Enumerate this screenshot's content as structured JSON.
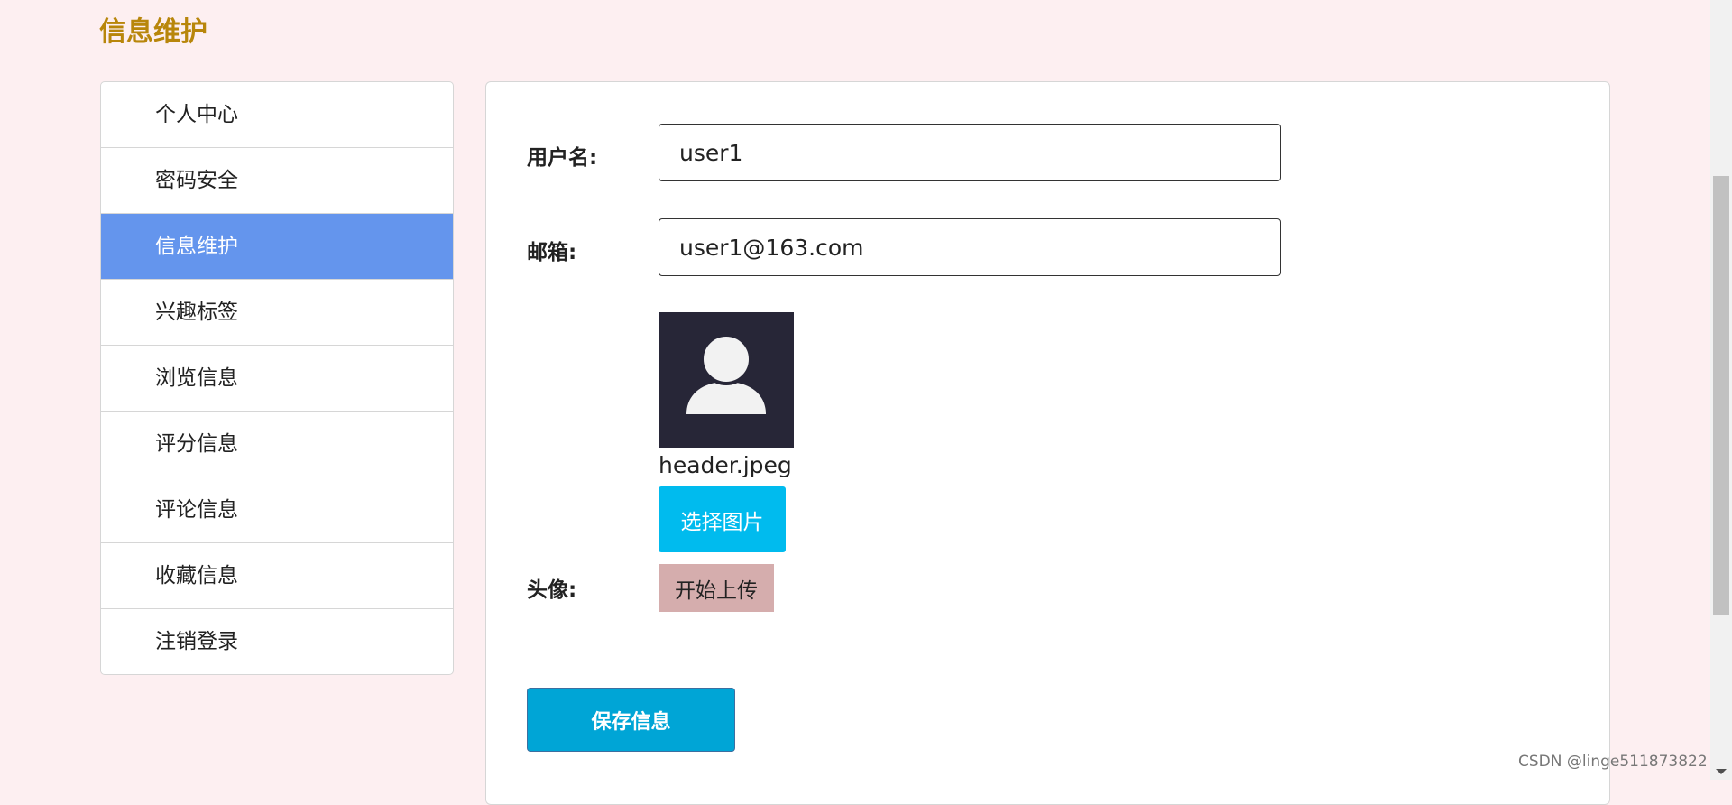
{
  "page_title": "信息维护",
  "sidebar": {
    "items": [
      {
        "label": "个人中心"
      },
      {
        "label": "密码安全"
      },
      {
        "label": "信息维护",
        "active": true
      },
      {
        "label": "兴趣标签"
      },
      {
        "label": "浏览信息"
      },
      {
        "label": "评分信息"
      },
      {
        "label": "评论信息"
      },
      {
        "label": "收藏信息"
      },
      {
        "label": "注销登录"
      }
    ]
  },
  "form": {
    "username_label": "用户名:",
    "username_value": "user1",
    "email_label": "邮箱:",
    "email_value": "user1@163.com",
    "avatar_label": "头像:",
    "avatar_file_name": "header.jpeg",
    "choose_image_label": "选择图片",
    "upload_label": "开始上传",
    "save_label": "保存信息"
  },
  "watermark": "CSDN @linge511873822",
  "colors": {
    "page_bg": "#fdeff1",
    "title": "#b8860b",
    "active_item": "#6495ed",
    "choose_button": "#00bbee",
    "upload_button": "#d5adad",
    "save_button": "#00a5d6",
    "avatar_bg": "#272637"
  },
  "icons": {
    "avatar": "user-avatar-icon"
  }
}
